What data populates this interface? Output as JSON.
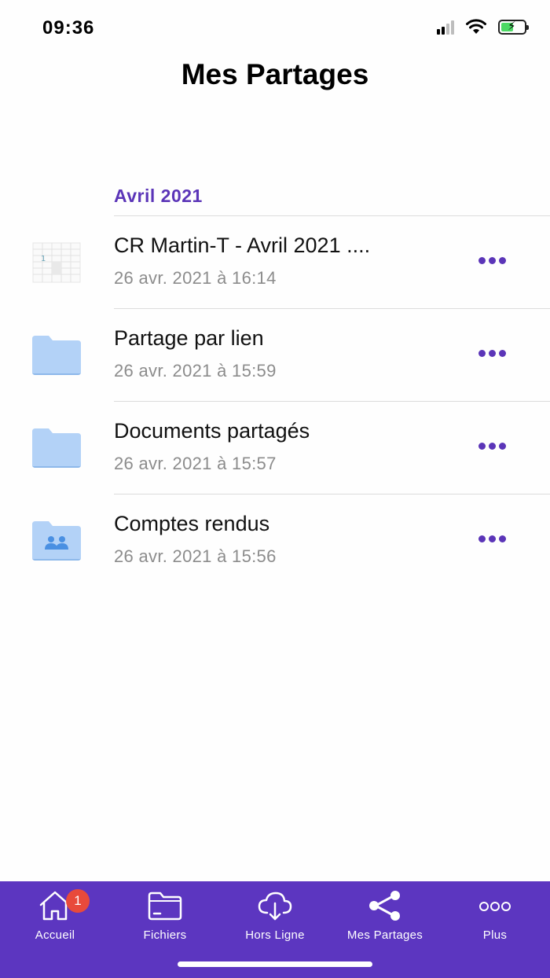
{
  "status": {
    "time": "09:36"
  },
  "header": {
    "title": "Mes Partages"
  },
  "section": {
    "title": "Avril 2021"
  },
  "items": [
    {
      "name": "CR Martin-T - Avril 2021 ....",
      "date": "26 avr. 2021 à 16:14",
      "icon": "spreadsheet-thumbnail-icon"
    },
    {
      "name": "Partage par lien",
      "date": "26 avr. 2021 à 15:59",
      "icon": "folder-icon"
    },
    {
      "name": "Documents partagés",
      "date": "26 avr. 2021 à 15:57",
      "icon": "folder-icon"
    },
    {
      "name": "Comptes rendus",
      "date": "26 avr. 2021 à 15:56",
      "icon": "shared-folder-icon"
    }
  ],
  "tabs": [
    {
      "label": "Accueil",
      "icon": "home-icon",
      "badge": "1"
    },
    {
      "label": "Fichiers",
      "icon": "folder-outline-icon"
    },
    {
      "label": "Hors Ligne",
      "icon": "cloud-download-icon"
    },
    {
      "label": "Mes Partages",
      "icon": "share-icon"
    },
    {
      "label": "Plus",
      "icon": "more-icon"
    }
  ],
  "colors": {
    "accent": "#5b35b8",
    "tab_bar": "#5c36c0",
    "folder": "#b3d2f7",
    "badge": "#e84a3b"
  }
}
